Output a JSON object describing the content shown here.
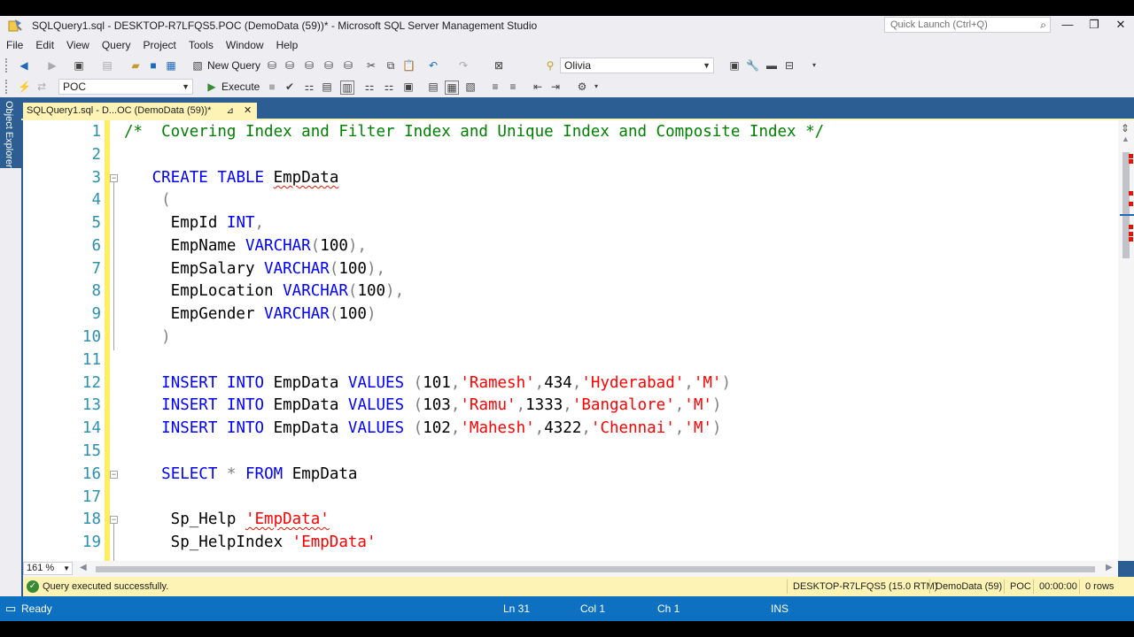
{
  "window": {
    "title": "SQLQuery1.sql - DESKTOP-R7LFQS5.POC (DemoData (59))* - Microsoft SQL Server Management Studio",
    "quick_launch_placeholder": "Quick Launch (Ctrl+Q)"
  },
  "menu": [
    "File",
    "Edit",
    "View",
    "Query",
    "Project",
    "Tools",
    "Window",
    "Help"
  ],
  "toolbar1": {
    "new_query_label": "New Query",
    "solution_config_value": "Olivia"
  },
  "toolbar2": {
    "database_value": "POC",
    "execute_label": "Execute"
  },
  "side_panel": {
    "object_explorer_label": "Object Explorer"
  },
  "tab": {
    "label": "SQLQuery1.sql - D...OC (DemoData (59))*"
  },
  "editor": {
    "line_numbers": [
      "1",
      "2",
      "3",
      "4",
      "5",
      "6",
      "7",
      "8",
      "9",
      "10",
      "11",
      "12",
      "13",
      "14",
      "15",
      "16",
      "17",
      "18",
      "19"
    ],
    "zoom": "161 %"
  },
  "query_status": {
    "message": "Query executed successfully.",
    "server": "DESKTOP-R7LFQS5 (15.0 RTM)",
    "login": "DemoData (59)",
    "database": "POC",
    "elapsed": "00:00:00",
    "rows": "0 rows"
  },
  "status_bar": {
    "state": "Ready",
    "line": "Ln 31",
    "column": "Col 1",
    "char": "Ch 1",
    "mode": "INS"
  },
  "colors": {
    "keyword": "#0000ff",
    "string": "#ff0000",
    "comment": "#008000",
    "line_number": "#2b91af",
    "status_bar": "#0e70c0",
    "tab_active": "#fcf3b5"
  }
}
